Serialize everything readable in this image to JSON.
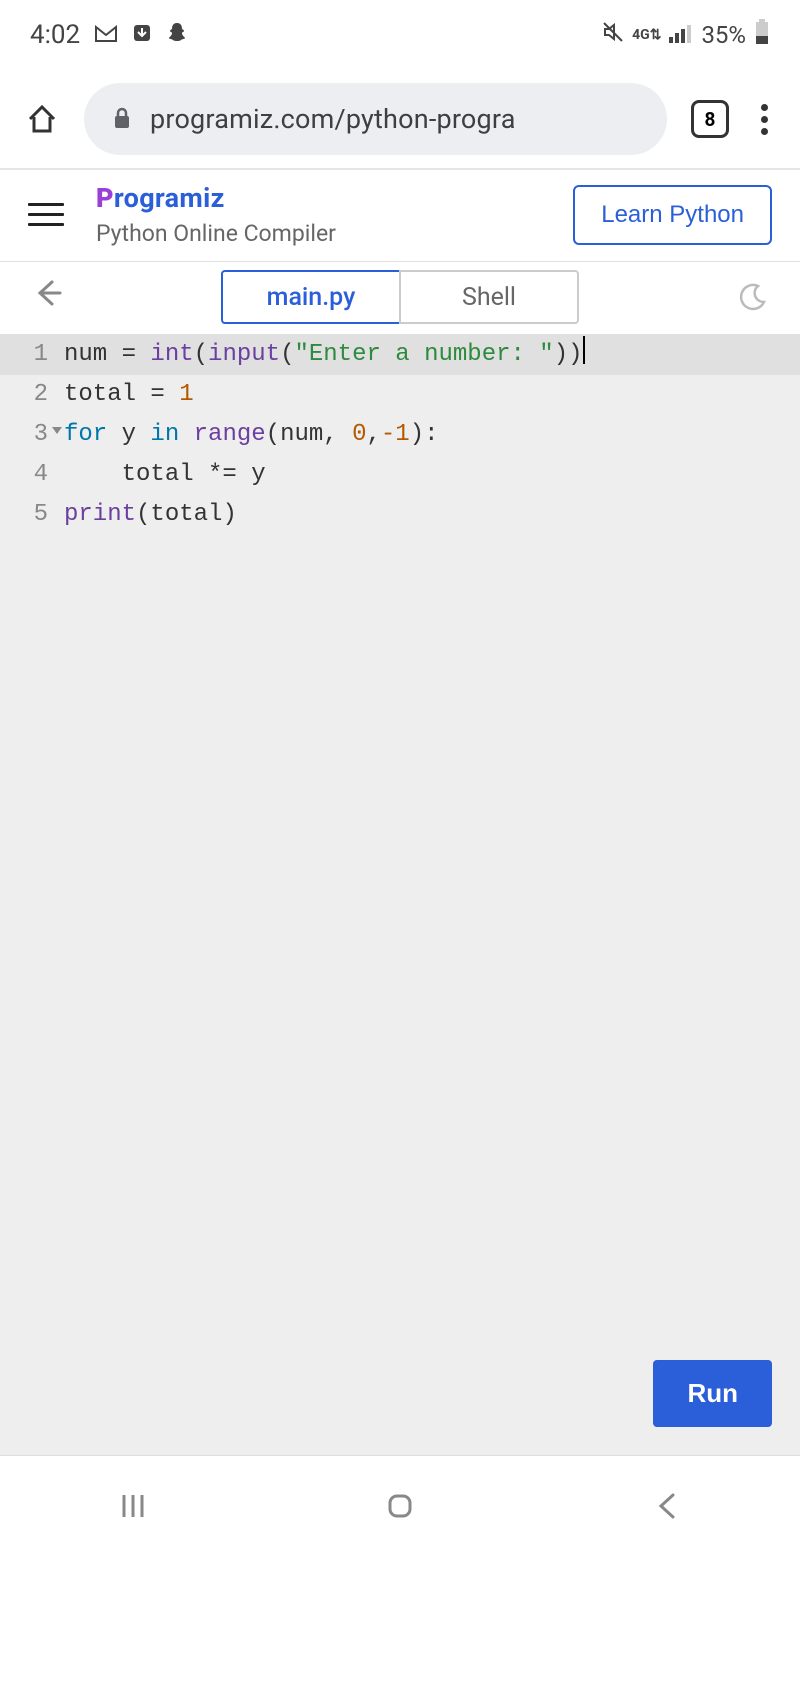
{
  "status": {
    "time": "4:02",
    "battery": "35%"
  },
  "browser": {
    "url": "programiz.com/python-progra",
    "tab_count": "8"
  },
  "header": {
    "brand": "rogramiz",
    "subtitle": "Python Online Compiler",
    "learn_label": "Learn Python"
  },
  "tabs": {
    "main": "main.py",
    "shell": "Shell"
  },
  "code": {
    "lines": [
      {
        "n": "1",
        "tokens": [
          {
            "t": "num ",
            "c": "tok-id"
          },
          {
            "t": "= ",
            "c": "tok-op"
          },
          {
            "t": "int",
            "c": "tok-builtin"
          },
          {
            "t": "(",
            "c": "tok-op"
          },
          {
            "t": "input",
            "c": "tok-builtin"
          },
          {
            "t": "(",
            "c": "tok-op"
          },
          {
            "t": "\"Enter a number: \"",
            "c": "tok-str"
          },
          {
            "t": "))",
            "c": "tok-op"
          }
        ],
        "hl": true,
        "cursor": true
      },
      {
        "n": "2",
        "tokens": [
          {
            "t": "total ",
            "c": "tok-id"
          },
          {
            "t": "= ",
            "c": "tok-op"
          },
          {
            "t": "1",
            "c": "tok-num"
          }
        ]
      },
      {
        "n": "3",
        "fold": true,
        "tokens": [
          {
            "t": "for ",
            "c": "tok-kw"
          },
          {
            "t": "y ",
            "c": "tok-id"
          },
          {
            "t": "in ",
            "c": "tok-kw"
          },
          {
            "t": "range",
            "c": "tok-builtin"
          },
          {
            "t": "(",
            "c": "tok-op"
          },
          {
            "t": "num",
            "c": "tok-id"
          },
          {
            "t": ", ",
            "c": "tok-op"
          },
          {
            "t": "0",
            "c": "tok-num"
          },
          {
            "t": ",",
            "c": "tok-op"
          },
          {
            "t": "-1",
            "c": "tok-num"
          },
          {
            "t": "):",
            "c": "tok-op"
          }
        ]
      },
      {
        "n": "4",
        "tokens": [
          {
            "t": "    total ",
            "c": "tok-id"
          },
          {
            "t": "*= ",
            "c": "tok-op"
          },
          {
            "t": "y",
            "c": "tok-id"
          }
        ]
      },
      {
        "n": "5",
        "tokens": [
          {
            "t": "print",
            "c": "tok-builtin"
          },
          {
            "t": "(",
            "c": "tok-op"
          },
          {
            "t": "total",
            "c": "tok-id"
          },
          {
            "t": ")",
            "c": "tok-op"
          }
        ]
      }
    ]
  },
  "run_label": "Run"
}
